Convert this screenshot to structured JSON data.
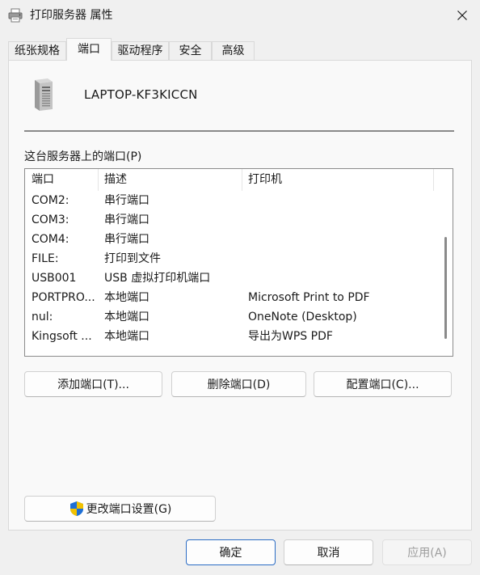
{
  "window": {
    "title": "打印服务器 属性"
  },
  "tabs": [
    {
      "label": "纸张规格"
    },
    {
      "label": "端口"
    },
    {
      "label": "驱动程序"
    },
    {
      "label": "安全"
    },
    {
      "label": "高级"
    }
  ],
  "active_tab": "端口",
  "server": {
    "name": "LAPTOP-KF3KICCN"
  },
  "ports_label": "这台服务器上的端口(P)",
  "list": {
    "columns": [
      "端口",
      "描述",
      "打印机"
    ],
    "rows": [
      {
        "port": "COM2:",
        "desc": "串行端口",
        "printer": ""
      },
      {
        "port": "COM3:",
        "desc": "串行端口",
        "printer": ""
      },
      {
        "port": "COM4:",
        "desc": "串行端口",
        "printer": ""
      },
      {
        "port": "FILE:",
        "desc": "打印到文件",
        "printer": ""
      },
      {
        "port": "USB001",
        "desc": "USB 虚拟打印机端口",
        "printer": ""
      },
      {
        "port": "PORTPRO...",
        "desc": "本地端口",
        "printer": "Microsoft Print to PDF"
      },
      {
        "port": "nul:",
        "desc": "本地端口",
        "printer": "OneNote (Desktop)"
      },
      {
        "port": "Kingsoft ...",
        "desc": "本地端口",
        "printer": "导出为WPS PDF"
      }
    ]
  },
  "buttons": {
    "add_port": "添加端口(T)...",
    "delete_port": "删除端口(D)",
    "configure_port": "配置端口(C)...",
    "change_settings": "更改端口设置(G)",
    "ok": "确定",
    "cancel": "取消",
    "apply": "应用(A)"
  },
  "colors": {
    "accent": "#2b6cc4",
    "shield_blue": "#1e6fd6",
    "shield_yellow": "#f2c200"
  },
  "icons": {
    "title": "printer-icon",
    "server": "server-tower-icon",
    "close": "close-icon",
    "uac": "shield-icon"
  }
}
